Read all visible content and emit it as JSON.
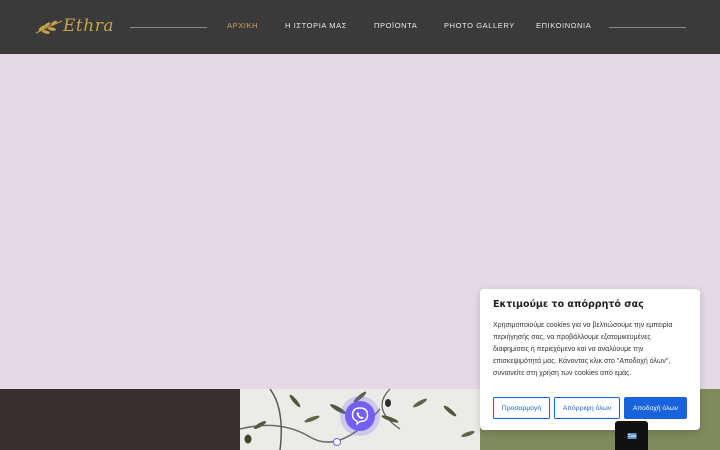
{
  "brand": {
    "logo_text": "Ethra",
    "accent_color": "#c9a24a"
  },
  "nav": {
    "items": [
      {
        "label": "ΑΡΧΙΚΗ",
        "active": true
      },
      {
        "label": "Η ΙΣΤΟΡΙΑ ΜΑΣ",
        "active": false
      },
      {
        "label": "ΠΡΟΪΟΝΤΑ",
        "active": false
      },
      {
        "label": "PHOTO GALLERY",
        "active": false
      },
      {
        "label": "ΕΠΙΚΟΙΝΩΝΙΑ",
        "active": false
      }
    ]
  },
  "colors": {
    "header_bg": "#3a3a3a",
    "hero_bg": "#e6d9e6",
    "active_nav": "#d2a063",
    "cookie_accent": "#1863dc",
    "viber": "#7360f2",
    "strip_dark": "#3a3030",
    "strip_green": "#7f8b5c"
  },
  "cookie": {
    "title": "Εκτιμούμε το απόρρητό σας",
    "text": "Χρησιμοποιούμε cookies για να βελτιώσουμε την εμπειρία περιήγησής σας, να προβάλλουμε εξατομικευμένες διαφημίσεις ή περιεχόμενο και να αναλύουμε την επισκεψιμότητά μας. Κάνοντας κλικ στο \"Αποδοχή όλων\", συναινείτε στη χρήση των cookies από εμάς.",
    "buttons": {
      "customize": "Προσαρμογή",
      "reject": "Απόρριψη όλων",
      "accept": "Αποδοχή όλων"
    }
  },
  "icons": {
    "viber": "viber-icon",
    "language_flag": "greek-flag-icon",
    "logo_leaf": "olive-leaf-icon"
  }
}
